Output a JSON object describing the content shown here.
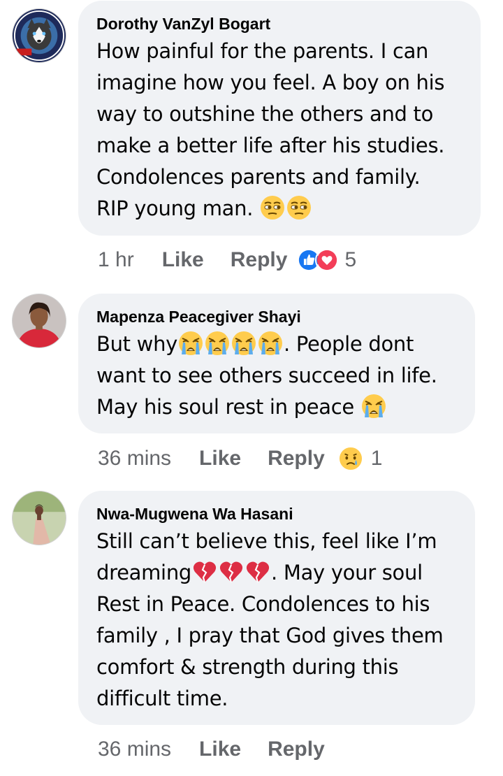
{
  "comments": [
    {
      "author": "Dorothy VanZyl Bogart",
      "lines": [
        "How painful for the parents. I can",
        "imagine how you feel. A boy on his",
        "way to outshine the others and to",
        "make a better life after his studies.",
        "Condolences parents and family.",
        "RIP young man. "
      ],
      "time": "1 hr",
      "like_label": "Like",
      "reply_label": "Reply",
      "reaction_icons": [
        "like-icon",
        "love-icon"
      ],
      "reaction_count": "5"
    },
    {
      "author": "Mapenza Peacegiver Shayi",
      "lines": [
        "But why",
        "want to see others succeed in life.",
        "May his soul rest in peace "
      ],
      "line1_after_emoji": ". People dont",
      "time": "36 mins",
      "like_label": "Like",
      "reply_label": "Reply",
      "reaction_icons": [
        "sad-icon"
      ],
      "reaction_count": "1"
    },
    {
      "author": "Nwa-Mugwena Wa Hasani",
      "lines": [
        "Still can’t believe this, feel like I’m",
        "dreaming",
        "Rest in Peace. Condolences to his",
        "family , I pray that God gives them",
        "comfort & strength during this",
        "difficult time."
      ],
      "line2_after_emoji": ".  May your soul",
      "time": "36 mins",
      "like_label": "Like",
      "reply_label": "Reply"
    }
  ],
  "colors": {
    "bubble": "#f0f2f5",
    "meta_text": "#65676b",
    "like_blue": "#1877f2",
    "love_red": "#f33e58"
  }
}
